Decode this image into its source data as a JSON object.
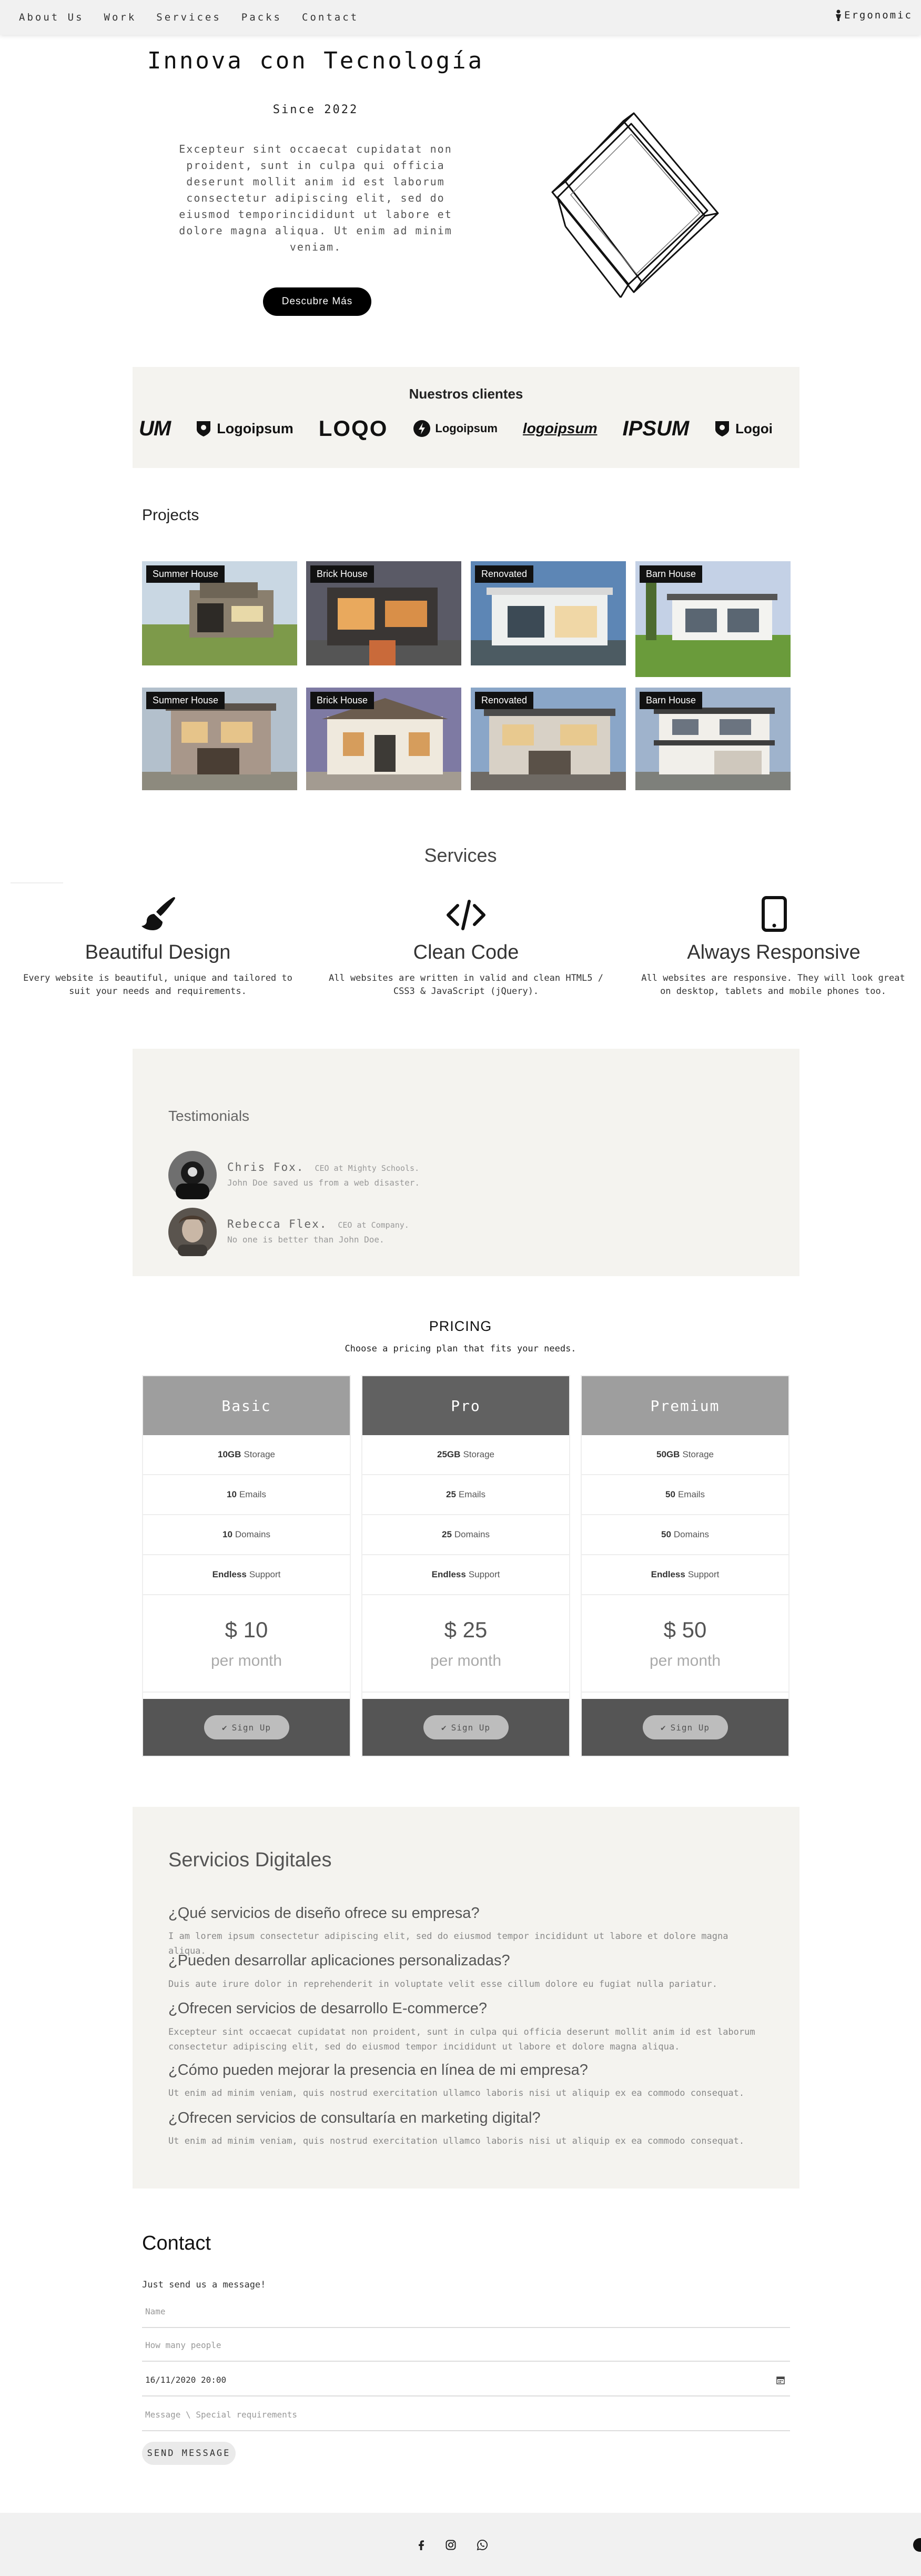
{
  "nav": {
    "items": [
      "About Us",
      "Work",
      "Services",
      "Packs",
      "Contact"
    ],
    "brand": "Ergonomic"
  },
  "hero": {
    "title": "Innova con Tecnología",
    "since": "Since 2022",
    "text": "Excepteur sint occaecat cupidatat non proident, sunt in culpa qui officia deserunt mollit anim id est laborum consectetur adipiscing elit, sed do eiusmod temporincididunt ut labore et dolore magna aliqua. Ut enim ad minim veniam.",
    "button": "Descubre Más"
  },
  "clients": {
    "title": "Nuestros clientes",
    "logos": [
      "UM",
      "Logoipsum",
      "LOQO",
      "Logoipsum",
      "logoipsum",
      "IPSUM",
      "Logoi"
    ]
  },
  "projects": {
    "title": "Projects",
    "items": [
      {
        "label": "Summer House"
      },
      {
        "label": "Brick House"
      },
      {
        "label": "Renovated"
      },
      {
        "label": "Barn House"
      },
      {
        "label": "Summer House"
      },
      {
        "label": "Brick House"
      },
      {
        "label": "Renovated"
      },
      {
        "label": "Barn House"
      }
    ]
  },
  "services": {
    "title": "Services",
    "items": [
      {
        "icon": "paint-brush-icon",
        "title": "Beautiful Design",
        "desc": "Every website is beautiful, unique and tailored to suit your needs and requirements."
      },
      {
        "icon": "code-icon",
        "title": "Clean Code",
        "desc": "All websites are written in valid and clean HTML5 / CSS3 & JavaScript (jQuery)."
      },
      {
        "icon": "tablet-icon",
        "title": "Always Responsive",
        "desc": "All websites are responsive. They will look great on desktop, tablets and mobile phones too."
      }
    ]
  },
  "testimonials": {
    "title": "Testimonials",
    "items": [
      {
        "name": "Chris Fox.",
        "role": "CEO at Mighty Schools.",
        "quote": "John Doe saved us from a web disaster."
      },
      {
        "name": "Rebecca Flex.",
        "role": "CEO at Company.",
        "quote": "No one is better than John Doe."
      }
    ]
  },
  "pricing": {
    "title": "PRICING",
    "subtitle": "Choose a pricing plan that fits your needs.",
    "plans": [
      {
        "name": "Basic",
        "color": "#9e9e9e",
        "storage_val": "10GB",
        "storage_lbl": "Storage",
        "emails_val": "10",
        "emails_lbl": "Emails",
        "domains_val": "10",
        "domains_lbl": "Domains",
        "support_val": "Endless",
        "support_lbl": "Support",
        "price": "$ 10",
        "period": "per month",
        "cta": "Sign Up"
      },
      {
        "name": "Pro",
        "color": "#616161",
        "storage_val": "25GB",
        "storage_lbl": "Storage",
        "emails_val": "25",
        "emails_lbl": "Emails",
        "domains_val": "25",
        "domains_lbl": "Domains",
        "support_val": "Endless",
        "support_lbl": "Support",
        "price": "$ 25",
        "period": "per month",
        "cta": "Sign Up"
      },
      {
        "name": "Premium",
        "color": "#9e9e9e",
        "storage_val": "50GB",
        "storage_lbl": "Storage",
        "emails_val": "50",
        "emails_lbl": "Emails",
        "domains_val": "50",
        "domains_lbl": "Domains",
        "support_val": "Endless",
        "support_lbl": "Support",
        "price": "$ 50",
        "period": "per month",
        "cta": "Sign Up"
      }
    ]
  },
  "faq": {
    "title": "Servicios Digitales",
    "items": [
      {
        "q": "¿Qué servicios de diseño ofrece su empresa?",
        "a": "I am lorem ipsum consectetur adipiscing elit, sed do eiusmod tempor incididunt ut labore et dolore magna aliqua."
      },
      {
        "q": "¿Pueden desarrollar aplicaciones personalizadas?",
        "a": "Duis aute irure dolor in reprehenderit in voluptate velit esse cillum dolore eu fugiat nulla pariatur."
      },
      {
        "q": "¿Ofrecen servicios de desarrollo E-commerce?",
        "a": "Excepteur sint occaecat cupidatat non proident, sunt in culpa qui officia deserunt mollit anim id est laborum consectetur adipiscing elit, sed do eiusmod tempor incididunt ut labore et dolore magna aliqua."
      },
      {
        "q": "¿Cómo pueden mejorar la presencia en línea de mi empresa?",
        "a": "Ut enim ad minim veniam, quis nostrud exercitation ullamco laboris nisi ut aliquip ex ea commodo consequat."
      },
      {
        "q": "¿Ofrecen servicios de consultaría en marketing digital?",
        "a": "Ut enim ad minim veniam, quis nostrud exercitation ullamco laboris nisi ut aliquip ex ea commodo consequat."
      }
    ]
  },
  "contact": {
    "title": "Contact",
    "subtitle": "Just send us a message!",
    "name_placeholder": "Name",
    "people_placeholder": "How many people",
    "datetime_value": "16/11/2020 20:00",
    "message_placeholder": "Message \\ Special requirements",
    "send": "SEND MESSAGE"
  },
  "footer": {
    "icons": [
      "facebook-icon",
      "instagram-icon",
      "whatsapp-icon"
    ]
  }
}
